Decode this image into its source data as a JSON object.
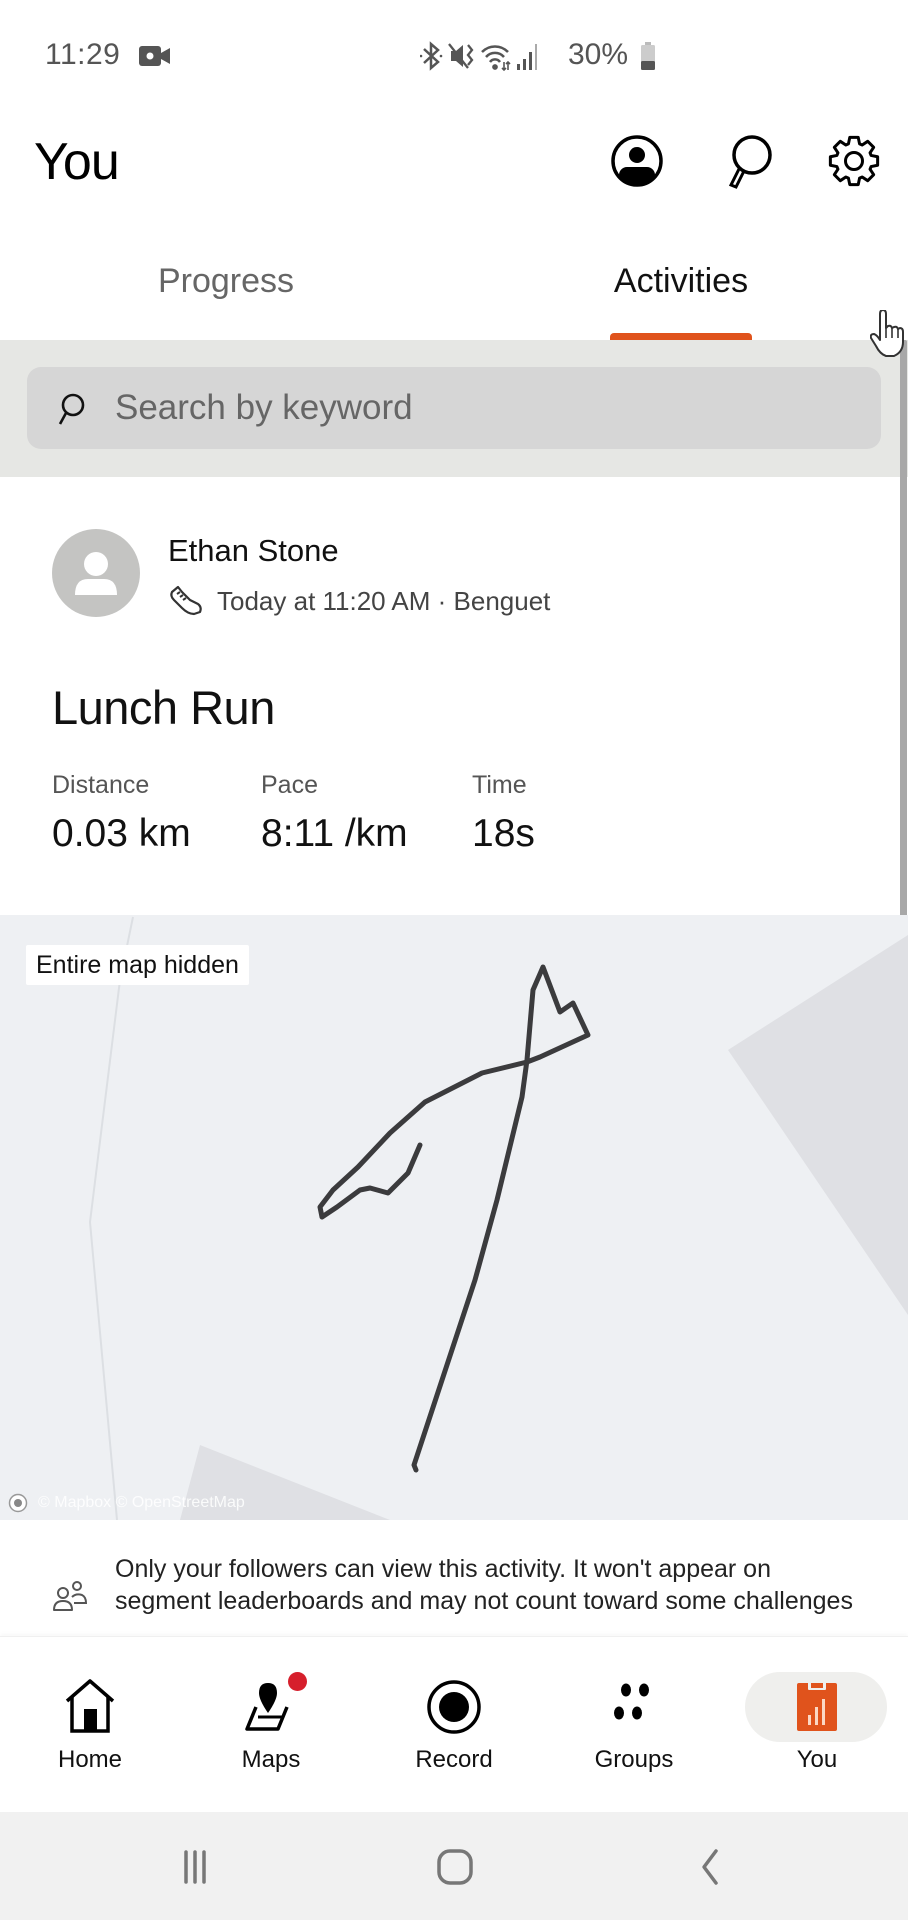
{
  "status_bar": {
    "time": "11:29",
    "battery_percent": "30%",
    "icons": [
      "video-record-icon",
      "bluetooth-icon",
      "mute-vibrate-icon",
      "wifi-icon",
      "signal-icon",
      "battery-icon"
    ]
  },
  "header": {
    "title": "You",
    "actions": [
      {
        "icon": "profile-circle-icon",
        "label": "Profile"
      },
      {
        "icon": "search-icon",
        "label": "Search"
      },
      {
        "icon": "gear-icon",
        "label": "Settings"
      }
    ]
  },
  "tabs": [
    {
      "label": "Progress",
      "active": false
    },
    {
      "label": "Activities",
      "active": true
    }
  ],
  "colors": {
    "accent": "#e0531c",
    "track": "#3b3b3d",
    "map_bg": "#eef0f3",
    "map_polygon": "#dfe0e4",
    "notification_dot": "#d61f2c"
  },
  "search": {
    "placeholder": "Search by keyword",
    "value": ""
  },
  "activity": {
    "athlete": "Ethan Stone",
    "sport_icon": "running-shoe-icon",
    "meta": "Today at 11:20 AM · Benguet",
    "title": "Lunch Run",
    "stats": [
      {
        "label": "Distance",
        "value": "0.03 km"
      },
      {
        "label": "Pace",
        "value": "8:11 /km"
      },
      {
        "label": "Time",
        "value": "18s"
      }
    ],
    "map": {
      "badge": "Entire map hidden",
      "attribution": "© Mapbox © OpenStreetMap"
    },
    "privacy_notice": "Only your followers can view this activity. It won't appear on segment leaderboards and may not count toward some challenges"
  },
  "bottom_nav": [
    {
      "label": "Home",
      "icon": "home-icon",
      "active": false
    },
    {
      "label": "Maps",
      "icon": "maps-icon",
      "active": false,
      "badge": true
    },
    {
      "label": "Record",
      "icon": "record-icon",
      "active": false
    },
    {
      "label": "Groups",
      "icon": "groups-icon",
      "active": false
    },
    {
      "label": "You",
      "icon": "you-stats-icon",
      "active": true
    }
  ],
  "system_nav": [
    "recent-apps",
    "home",
    "back"
  ]
}
